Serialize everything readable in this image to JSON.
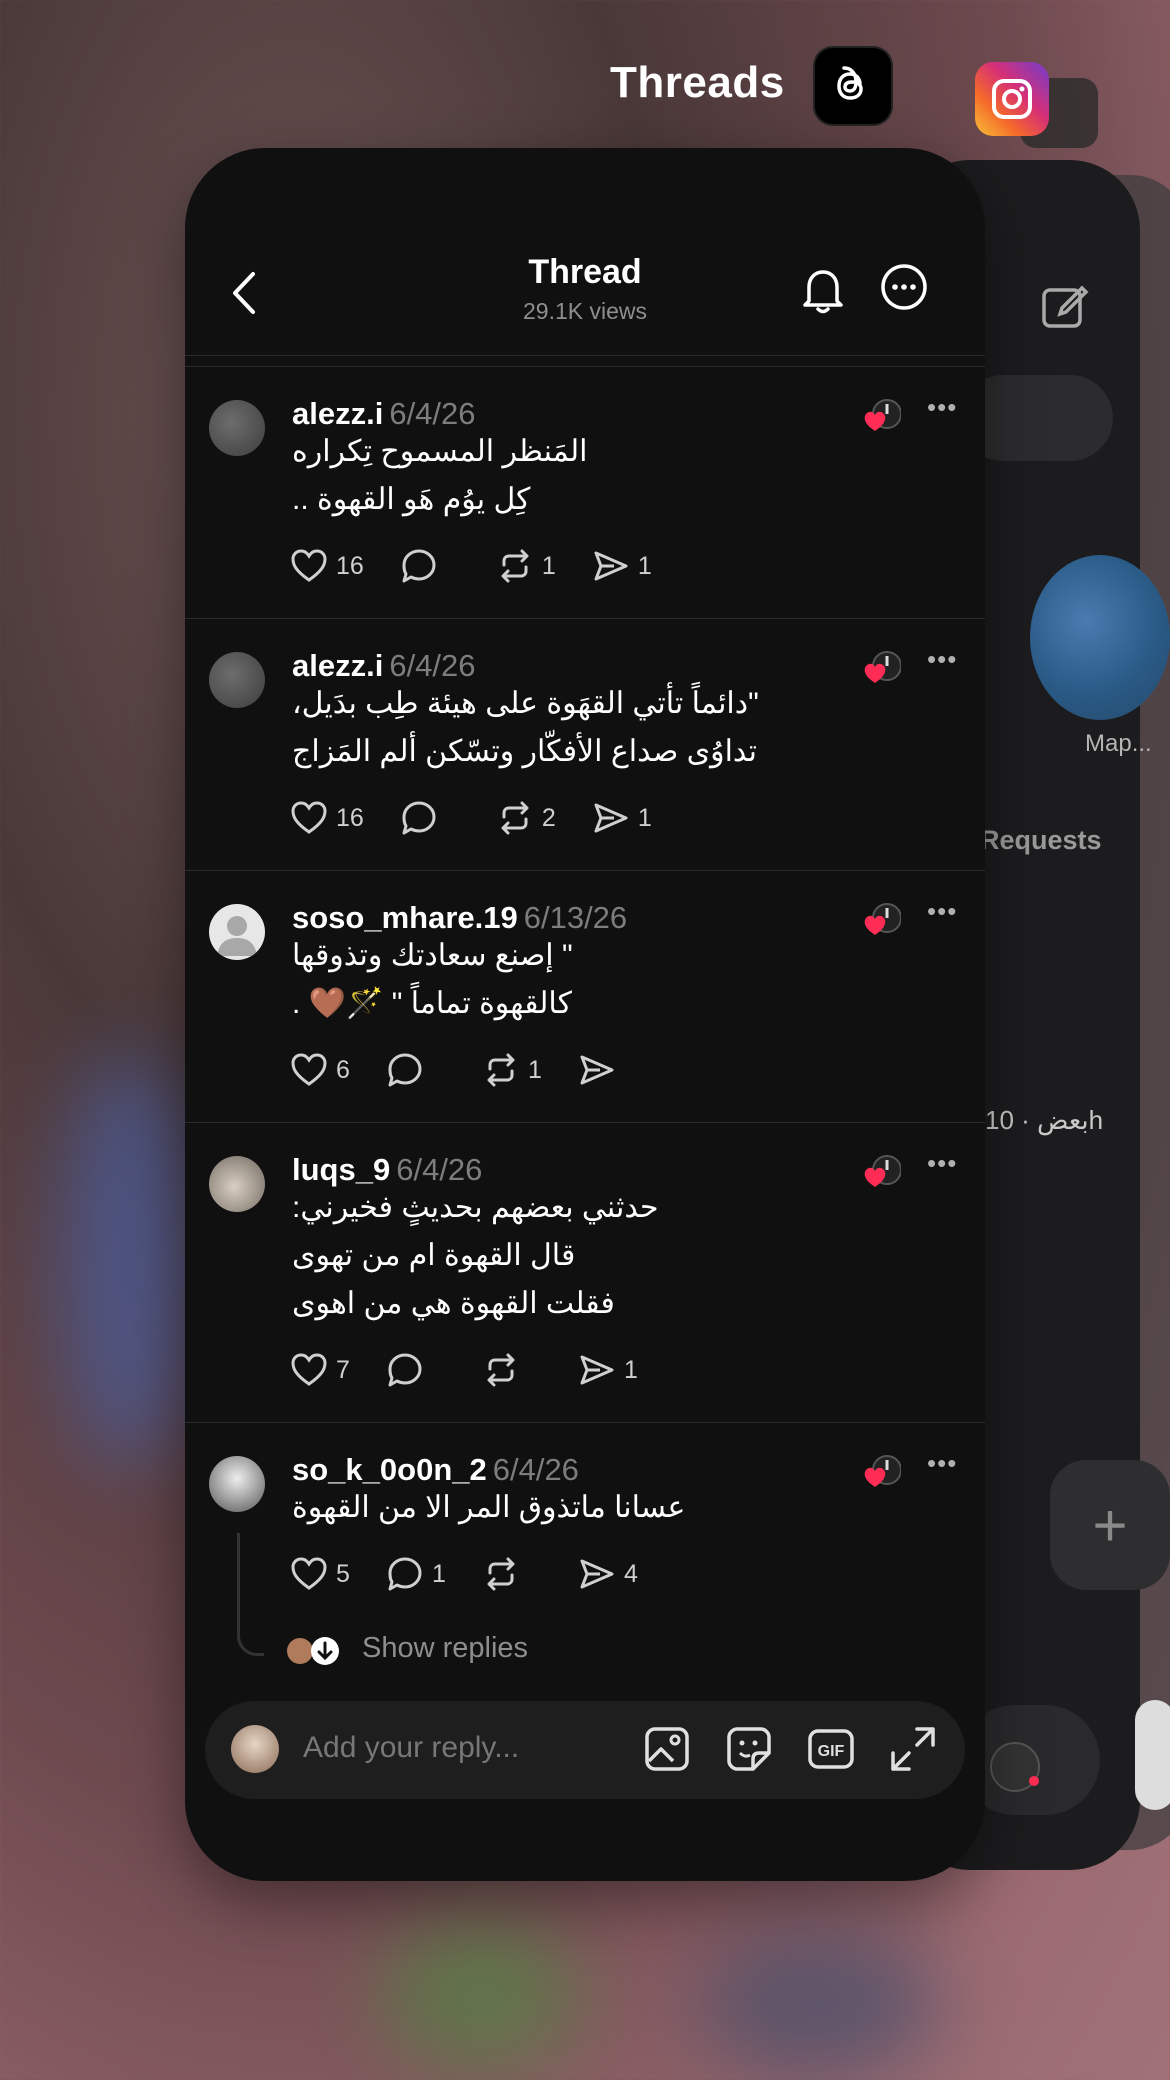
{
  "switcher": {
    "app_name": "Threads"
  },
  "background_card": {
    "map_label": "Map...",
    "requests_label": "Requests",
    "time_text": "بعض · 10h"
  },
  "thread": {
    "title": "Thread",
    "views": "29.1K views"
  },
  "posts": [
    {
      "user": "alezz.i",
      "date": "6/4/26",
      "lines": [
        "المَنظر المسموح تِكراره",
        "كِل يوُم هَو القهوة .."
      ],
      "likes": "16",
      "comments": "",
      "reposts": "1",
      "shares": "1"
    },
    {
      "user": "alezz.i",
      "date": "6/4/26",
      "lines": [
        "\"دائماً تأتي القهَوة على هيئة طِب بدَيل،",
        "تداوُى صداع الأفكّار وتسّكن ألم المَزاج"
      ],
      "likes": "16",
      "comments": "",
      "reposts": "2",
      "shares": "1"
    },
    {
      "user": "soso_mhare.19",
      "date": "6/13/26",
      "lines": [
        "\" إصنع سعادتك وتذوقها",
        "كالقهوة تماماً \" 🪄🤎 ."
      ],
      "likes": "6",
      "comments": "",
      "reposts": "1",
      "shares": ""
    },
    {
      "user": "luqs_9",
      "date": "6/4/26",
      "lines": [
        "حدثني بعضهم بحديثٍ فخيرني:",
        "قال القهوة ام من تهوى",
        "فقلت القهوة هي من اهوى"
      ],
      "likes": "7",
      "comments": "",
      "reposts": "",
      "shares": "1"
    },
    {
      "user": "so_k_0o0n_2",
      "date": "6/4/26",
      "lines": [
        "عسانا ماتذوق المر الا من القهوة"
      ],
      "likes": "5",
      "comments": "1",
      "reposts": "",
      "shares": "4"
    }
  ],
  "show_replies": "Show replies",
  "reply_bar": {
    "placeholder": "Add your reply..."
  },
  "icons": {
    "back": "chevron-left-icon",
    "bell": "bell-icon",
    "more": "more-circle-icon",
    "like": "heart-icon",
    "comment": "comment-icon",
    "repost": "repost-icon",
    "share": "send-icon",
    "image": "image-icon",
    "sticker": "sticker-icon",
    "gif": "gif-icon",
    "expand": "expand-icon"
  },
  "colors": {
    "card": "#101010",
    "text": "#ffffff",
    "muted": "#7d7d7d",
    "heart": "#ff2d55"
  }
}
